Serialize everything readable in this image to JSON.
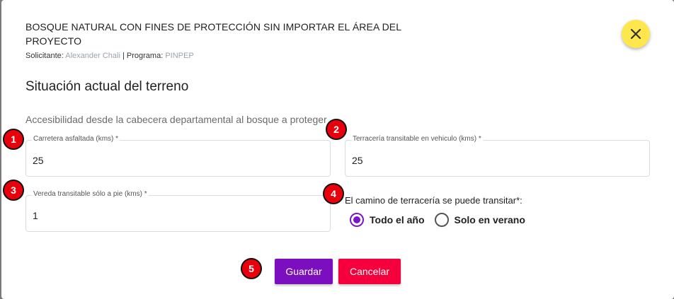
{
  "header": {
    "title": "BOSQUE NATURAL CON FINES DE PROTECCIÓN SIN IMPORTAR EL ÁREA DEL PROYECTO",
    "solicitante_label": "Solicitante:",
    "solicitante_value": "Alexander Chali",
    "separator": "|",
    "programa_label": "Programa:",
    "programa_value": "PINPEP"
  },
  "section": {
    "title": "Situación actual del terreno",
    "subtitle": "Accesibilidad desde la cabecera departamental al bosque a proteger"
  },
  "fields": {
    "carretera": {
      "label": "Carretera asfaltada (kms) *",
      "value": "25"
    },
    "terraceria": {
      "label": "Terracería transitable en vehiculo (kms) *",
      "value": "25"
    },
    "vereda": {
      "label": "Vereda transitable sólo a pie (kms) *",
      "value": "1"
    }
  },
  "transit": {
    "label": "El camino de terracería se puede transitar*:",
    "options": [
      {
        "label": "Todo el año",
        "checked": true
      },
      {
        "label": "Solo en verano",
        "checked": false
      }
    ]
  },
  "actions": {
    "save": "Guardar",
    "cancel": "Cancelar"
  },
  "badges": [
    "1",
    "2",
    "3",
    "4",
    "5"
  ],
  "colors": {
    "accent": "#7b0fbf",
    "danger": "#f5003d",
    "close": "#fde74c",
    "badge": "#e8000c"
  }
}
